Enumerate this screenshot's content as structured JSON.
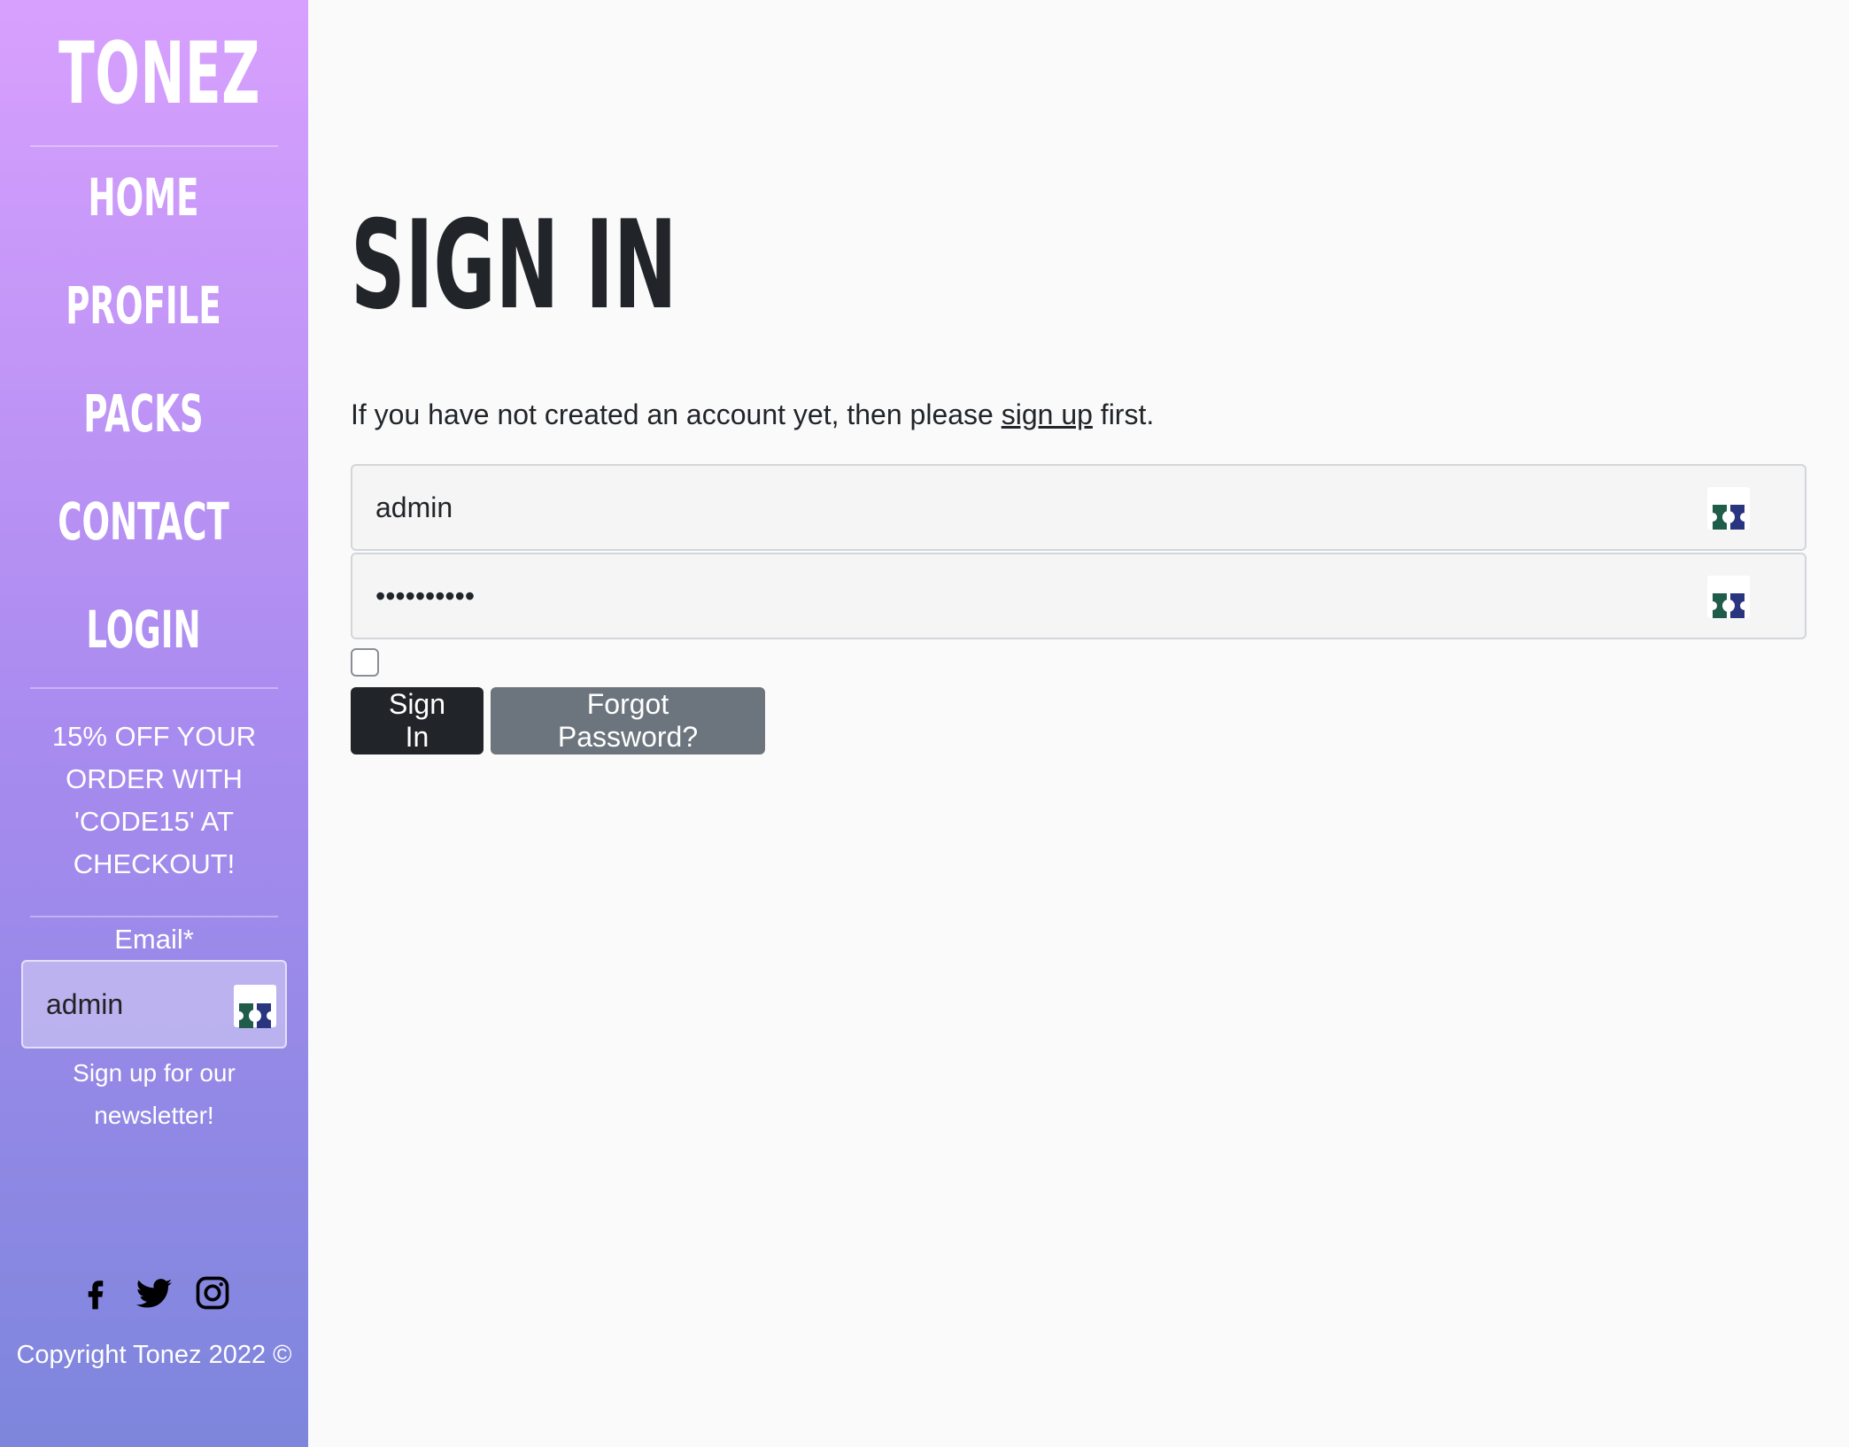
{
  "brand": {
    "logo": "TONEZ"
  },
  "nav": {
    "items": [
      {
        "label": "HOME"
      },
      {
        "label": "PROFILE"
      },
      {
        "label": "PACKS"
      },
      {
        "label": "CONTACT"
      },
      {
        "label": "LOGIN"
      }
    ]
  },
  "promo": {
    "text": "15% OFF YOUR ORDER WITH 'CODE15' AT CHECKOUT!"
  },
  "newsletter": {
    "email_label": "Email*",
    "email_value": "admin",
    "text": "Sign up for our newsletter!"
  },
  "social": {
    "icons": [
      "facebook-icon",
      "twitter-icon",
      "instagram-icon"
    ]
  },
  "footer": {
    "copyright": "Copyright Tonez 2022 ©"
  },
  "main": {
    "title": "SIGN IN",
    "intro_before": "If you have not created an account yet, then please ",
    "intro_link": "sign up",
    "intro_after": " first.",
    "username_value": "admin",
    "password_value": "••••••••••",
    "signin_label": "Sign In",
    "forgot_label": "Forgot Password?"
  },
  "colors": {
    "sidebar_top": "#d8a0fe",
    "sidebar_bottom": "#7d86dc",
    "primary_button": "#212529",
    "secondary_button": "#6c757d",
    "page_background": "#fafafa"
  }
}
